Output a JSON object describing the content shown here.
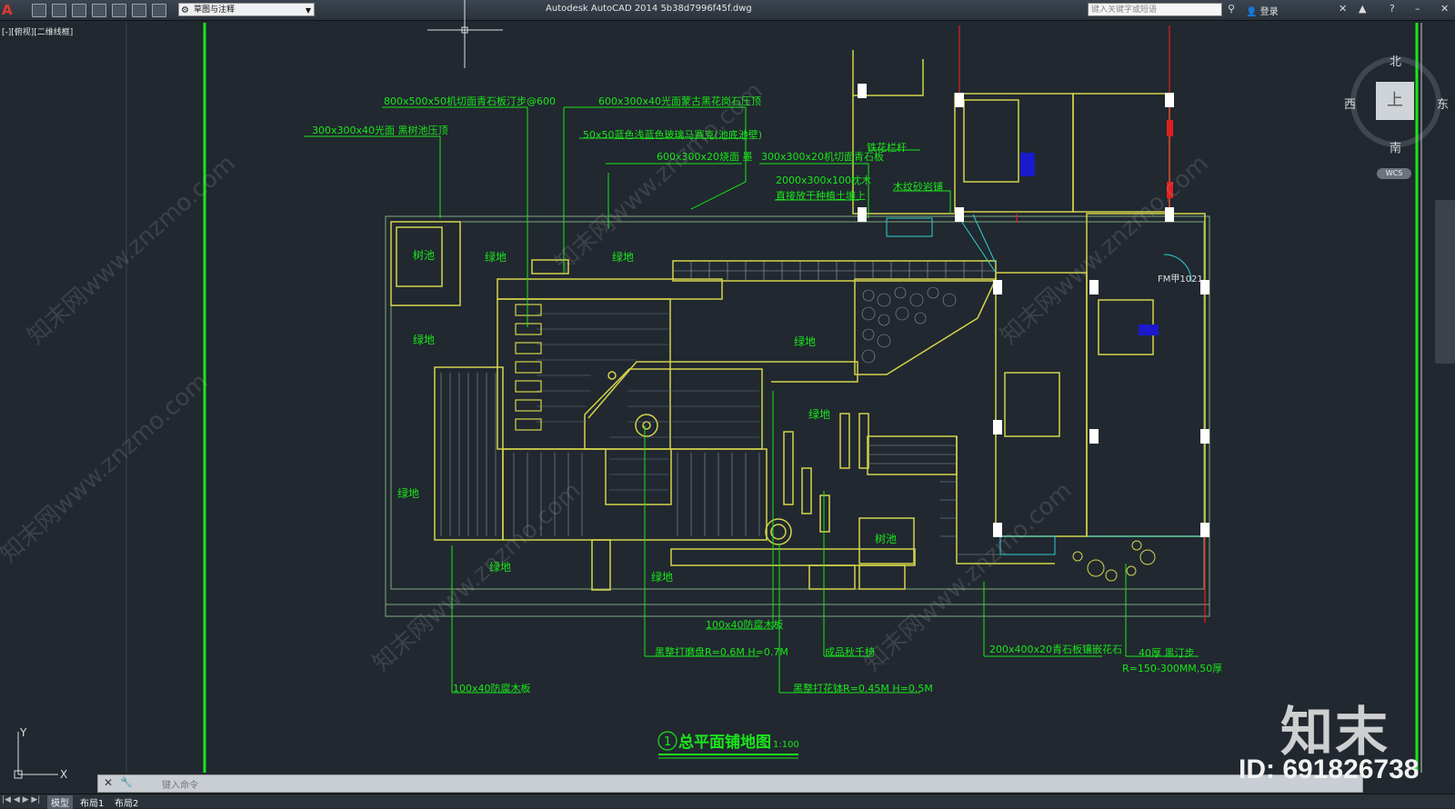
{
  "app": {
    "title": "Autodesk AutoCAD 2014    5b38d7996f45f.dwg",
    "workspace": "草图与注释",
    "search_placeholder": "键入关键字或短语",
    "login": "登录",
    "viewport_label": "[-][俯视][二维线框]",
    "command_prompt": "键入命令"
  },
  "tabs": {
    "model": "模型",
    "layout1": "布局1",
    "layout2": "布局2"
  },
  "viewcube": {
    "north": "北",
    "south": "南",
    "east": "东",
    "west": "西",
    "face": "上",
    "wcs": "WCS"
  },
  "ucs": {
    "x": "X",
    "y": "Y"
  },
  "drawing": {
    "title_num": "1",
    "title": "总平面铺地图",
    "scale": "1:100",
    "door_tag": "FM甲1021",
    "annotations": {
      "a1": "800x500x50机切面青石板汀步@600",
      "a2": "600x300x40光面蒙古黑花岗石压顶",
      "a3": "300x300x40光面 黑树池压顶",
      "a4": "50x50蓝色浅蓝色玻璃马赛克(池底池壁)",
      "a5": "600x300x20烧面 墨",
      "a6": "300x300x20机切面青石板",
      "a7": "铁花栏杆",
      "a8": "2000x300x100枕木",
      "a9": "直接放于种植土壤上",
      "a10": "木纹砂岩铺",
      "a11": "100x40防腐木板",
      "a12": "黑整打磨盘R=0.6M H=0.7M",
      "a13": "成品秋千椅",
      "a14": "200x400x20青石板镶嵌花石",
      "a15": "40厚 黑汀步",
      "a16": "R=150-300MM,50厚",
      "a17": "100x40防腐木板",
      "a18": "黑整打花钵R=0.45M H=0.5M"
    },
    "rooms": {
      "tree1": "树池",
      "tree2": "树池",
      "g1": "绿地",
      "g2": "绿地",
      "g3": "绿地",
      "g4": "绿地",
      "g5": "绿地",
      "g6": "绿地",
      "g7": "绿地",
      "g8": "绿地"
    }
  },
  "watermark": {
    "brand": "知末",
    "id": "ID: 691826738",
    "site": "知末网www.znzmo.com"
  }
}
